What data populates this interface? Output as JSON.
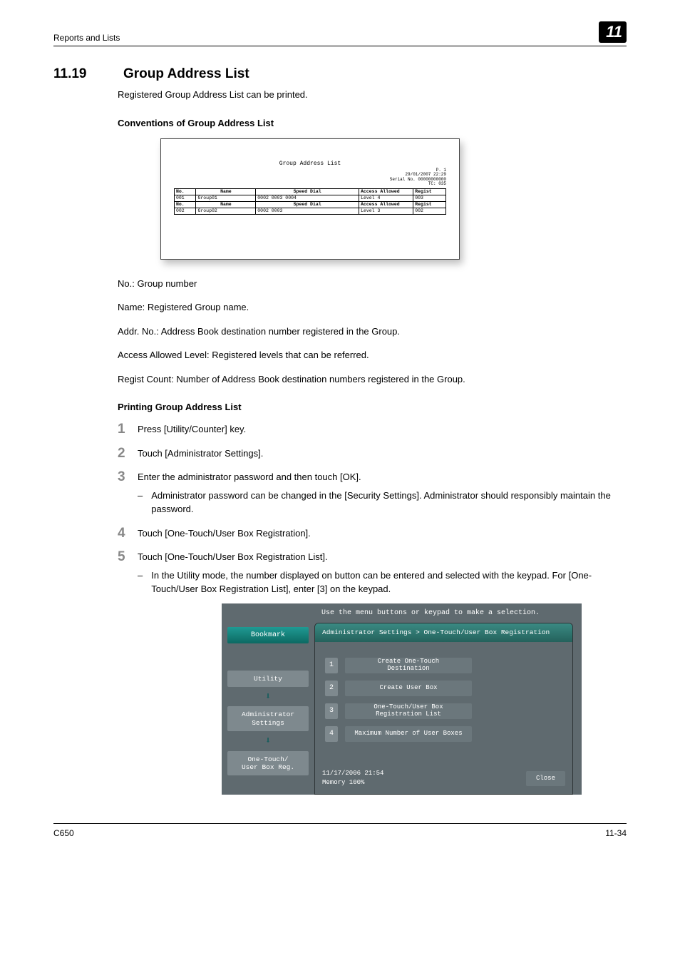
{
  "header": {
    "breadcrumb": "Reports and Lists",
    "chapter": "11"
  },
  "section": {
    "number": "11.19",
    "title": "Group Address List"
  },
  "intro": "Registered Group Address List can be printed.",
  "sub1": "Conventions of Group Address List",
  "fig1": {
    "title": "Group Address List",
    "meta": {
      "page": "P.  1",
      "date": "29/01/2007 22:29",
      "serial_label": "Serial No.",
      "serial": "00000000000 ",
      "tc_label": "TC:",
      "tc": "035"
    },
    "cols1": [
      "No.",
      "Name",
      "Speed Dial",
      "Access Allowed",
      "Regist"
    ],
    "row1": [
      "001",
      "Group01",
      "0002 0003 0004",
      "Level 4",
      "003"
    ],
    "cols2": [
      "No.",
      "Name",
      "Speed Dial",
      "Access Allowed",
      "Regist"
    ],
    "row2": [
      "002",
      "Group02",
      "0002 0003",
      "Level 3",
      "002"
    ]
  },
  "defs": {
    "d1": "No.: Group number",
    "d2": "Name: Registered Group name.",
    "d3": "Addr. No.: Address Book destination number registered in the Group.",
    "d4": "Access Allowed Level: Registered levels that can be referred.",
    "d5": "Regist Count: Number of Address Book destination numbers registered in the Group."
  },
  "sub2": "Printing Group Address List",
  "steps": {
    "s1": "Press [Utility/Counter] key.",
    "s2": "Touch [Administrator Settings].",
    "s3": "Enter the administrator password and then touch [OK].",
    "s3a": "Administrator password can be changed in the [Security Settings]. Administrator should responsibly maintain the password.",
    "s4": "Touch [One-Touch/User Box Registration].",
    "s5": "Touch [One-Touch/User Box Registration List].",
    "s5a": "In the Utility mode, the number displayed on button can be entered and selected with the keypad. For [One-Touch/User Box Registration List], enter [3] on the keypad."
  },
  "fig2": {
    "top": "Use the menu buttons or keypad to make a selection.",
    "bookmark": "Bookmark",
    "side": {
      "utility": "Utility",
      "admin": "Administrator Settings",
      "onetouch": "One-Touch/\nUser Box Reg."
    },
    "crumb": "Administrator Settings > One-Touch/User Box Registration",
    "menu": {
      "m1": "Create One-Touch\nDestination",
      "m2": "Create User Box",
      "m3": "One-Touch/User Box\nRegistration List",
      "m4": "Maximum Number of User Boxes"
    },
    "footer": {
      "dt": "11/17/2006    21:54",
      "mem": "Memory        100%",
      "close": "Close"
    }
  },
  "footer": {
    "left": "C650",
    "right": "11-34"
  }
}
